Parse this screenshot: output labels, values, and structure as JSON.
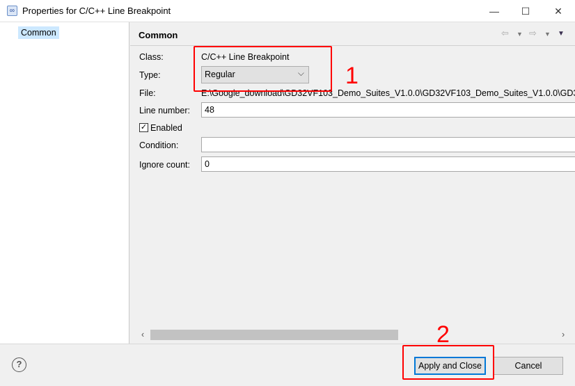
{
  "window": {
    "title": "Properties for C/C++ Line Breakpoint",
    "app_icon": "eclipse-breakpoint-icon"
  },
  "sidebar": {
    "items": [
      {
        "label": "Common",
        "selected": true
      }
    ]
  },
  "panel": {
    "title": "Common",
    "class_label": "Class:",
    "class_value": "C/C++ Line Breakpoint",
    "type_label": "Type:",
    "type_value": "Regular",
    "file_label": "File:",
    "file_value": "E:\\Google_download\\GD32VF103_Demo_Suites_V1.0.0\\GD32VF103_Demo_Suites_V1.0.0\\GD3",
    "line_label": "Line number:",
    "line_value": "48",
    "enabled_label": "Enabled",
    "enabled": true,
    "condition_label": "Condition:",
    "condition_value": "",
    "ignore_label": "Ignore count:",
    "ignore_value": "0"
  },
  "buttons": {
    "apply_close": "Apply and Close",
    "cancel": "Cancel",
    "help": "?"
  },
  "annotations": {
    "one": "1",
    "two": "2",
    "color": "#ff0000"
  },
  "colors": {
    "selection": "#cce8ff",
    "focus": "#0078d7"
  }
}
